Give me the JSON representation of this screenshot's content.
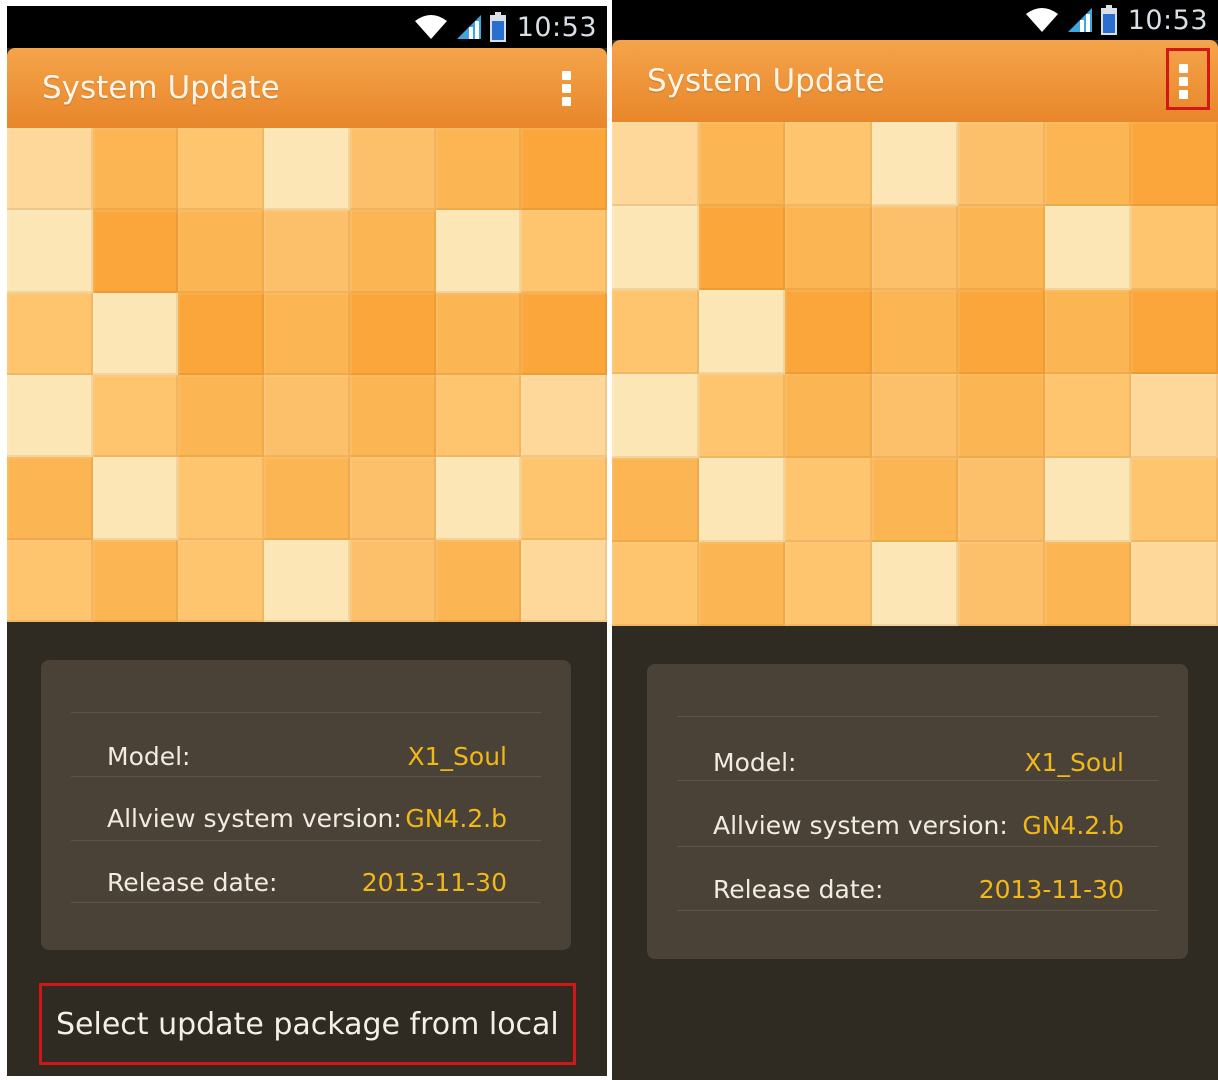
{
  "status_bar": {
    "time": "10:53",
    "icons": [
      "wifi-icon",
      "signal-icon",
      "battery-icon"
    ]
  },
  "app": {
    "title": "System Update"
  },
  "info": {
    "model_label": "Model:",
    "model_value": "X1_Soul",
    "version_label": "Allview system version:",
    "version_value": "GN4.2.b",
    "release_label": "Release date:",
    "release_value": "2013-11-30"
  },
  "menu": {
    "local_option": "Select update package from local"
  },
  "colors": {
    "accent": "#e8862a",
    "value_text": "#f0b818",
    "highlight": "#cf1717",
    "background": "#2f2a22",
    "card": "#4a4236"
  },
  "mosaic_palette": [
    "#fdd89a",
    "#fbb653",
    "#fec46e",
    "#fde6b6",
    "#fdc06a",
    "#fba63b",
    "#fdcc82"
  ]
}
